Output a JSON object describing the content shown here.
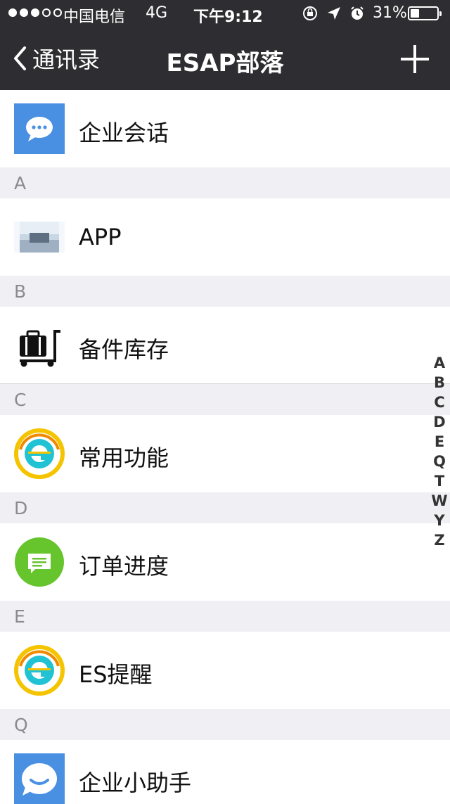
{
  "status_bar": {
    "carrier": "中国电信",
    "network": "4G",
    "time": "下午9:12",
    "battery": "31%"
  },
  "nav": {
    "back_label": "通讯录",
    "title": "ESAP部落",
    "add_icon": "plus-icon"
  },
  "top_item": {
    "label": "企业会话",
    "icon": "chat-bubble-icon"
  },
  "sections": [
    {
      "letter": "A",
      "items": [
        {
          "label": "APP",
          "icon": "app-thumbnail"
        }
      ]
    },
    {
      "letter": "B",
      "items": [
        {
          "label": "备件库存",
          "icon": "luggage-cart-icon"
        }
      ]
    },
    {
      "letter": "C",
      "items": [
        {
          "label": "常用功能",
          "icon": "e-logo-icon"
        }
      ]
    },
    {
      "letter": "D",
      "items": [
        {
          "label": "订单进度",
          "icon": "message-icon"
        }
      ]
    },
    {
      "letter": "E",
      "items": [
        {
          "label": "ES提醒",
          "icon": "e-logo-icon"
        }
      ]
    },
    {
      "letter": "Q",
      "items": [
        {
          "label": "企业小助手",
          "icon": "smile-chat-icon"
        }
      ]
    }
  ],
  "index_letters": [
    "A",
    "B",
    "C",
    "D",
    "E",
    "Q",
    "T",
    "W",
    "Y",
    "Z"
  ],
  "colors": {
    "header_bg": "#2e2e32",
    "section_bg": "#efeff4",
    "chat_blue": "#4a90e2",
    "green": "#66c42c"
  }
}
